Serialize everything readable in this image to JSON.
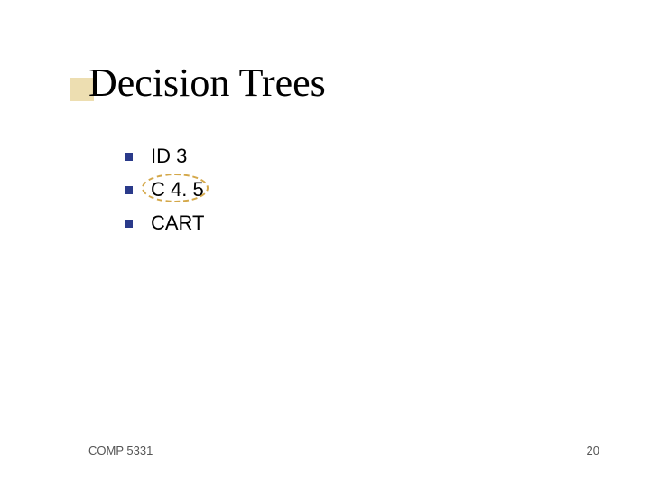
{
  "slide": {
    "title": "Decision Trees",
    "bullets": [
      {
        "text": "ID 3"
      },
      {
        "text": "C 4. 5"
      },
      {
        "text": "CART"
      }
    ],
    "footer": {
      "course": "COMP 5331",
      "page": "20"
    }
  }
}
